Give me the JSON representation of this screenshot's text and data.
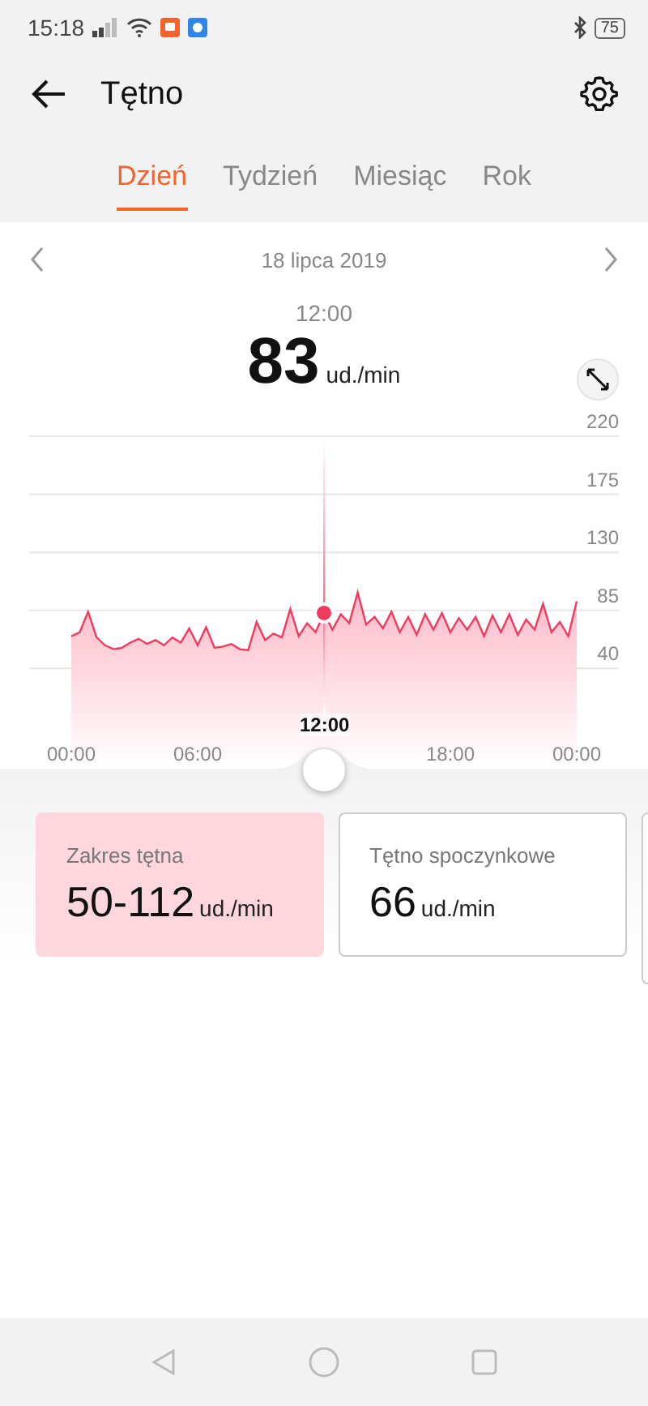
{
  "status_bar": {
    "time": "15:18",
    "battery": "75"
  },
  "header": {
    "title": "Tętno"
  },
  "tabs": [
    {
      "label": "Dzień",
      "selected": true
    },
    {
      "label": "Tydzień",
      "selected": false
    },
    {
      "label": "Miesiąc",
      "selected": false
    },
    {
      "label": "Rok",
      "selected": false
    }
  ],
  "date": "18 lipca 2019",
  "reading": {
    "time": "12:00",
    "value": "83",
    "unit": "ud./min"
  },
  "chart": {
    "cursor_label": "12:00",
    "chart_data": {
      "type": "area",
      "grid": true,
      "ref_lines": [
        {
          "axis": "x",
          "value": 12
        }
      ],
      "xlim": [
        0,
        24
      ],
      "ylim": [
        0,
        220
      ],
      "xticks": [
        {
          "value": 0,
          "label": "00:00"
        },
        {
          "value": 6,
          "label": "06:00"
        },
        {
          "value": 18,
          "label": "18:00"
        },
        {
          "value": 24,
          "label": "00:00"
        }
      ],
      "yticks": [
        220,
        175,
        130,
        85,
        40
      ],
      "x": [
        0,
        0.4,
        0.8,
        1.2,
        1.6,
        2,
        2.4,
        2.8,
        3.2,
        3.6,
        4,
        4.4,
        4.8,
        5.2,
        5.6,
        6,
        6.4,
        6.8,
        7.2,
        7.6,
        8,
        8.4,
        8.8,
        9.2,
        9.6,
        10,
        10.4,
        10.8,
        11.2,
        11.6,
        12,
        12.4,
        12.8,
        13.2,
        13.6,
        14,
        14.4,
        14.8,
        15.2,
        15.6,
        16,
        16.4,
        16.8,
        17.2,
        17.6,
        18,
        18.4,
        18.8,
        19.2,
        19.6,
        20,
        20.4,
        20.8,
        21.2,
        21.6,
        22,
        22.4,
        22.8,
        23.2,
        23.6,
        24
      ],
      "series": [
        {
          "color": "#f23a5f",
          "values": [
            65,
            68,
            84,
            64,
            58,
            55,
            56,
            60,
            63,
            59,
            62,
            58,
            64,
            60,
            71,
            58,
            72,
            56,
            57,
            59,
            55,
            54,
            76,
            62,
            67,
            64,
            86,
            65,
            75,
            68,
            83,
            70,
            82,
            75,
            99,
            74,
            80,
            71,
            84,
            68,
            80,
            66,
            82,
            70,
            83,
            68,
            79,
            70,
            80,
            65,
            81,
            68,
            82,
            66,
            78,
            70,
            90,
            68,
            76,
            65,
            92
          ]
        }
      ]
    }
  },
  "cards": [
    {
      "title": "Zakres tętna",
      "value": "50-112",
      "unit": "ud./min",
      "selected": true
    },
    {
      "title": "Tętno spoczynkowe",
      "value": "66",
      "unit": "ud./min",
      "selected": false
    }
  ]
}
